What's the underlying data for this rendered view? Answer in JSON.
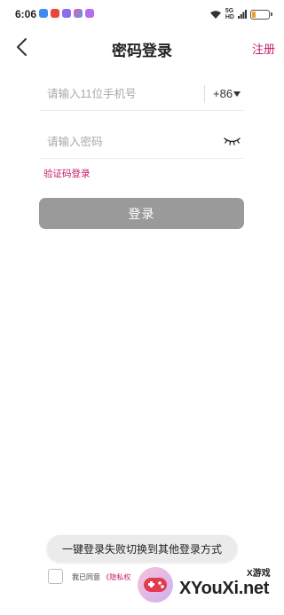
{
  "status_bar": {
    "time": "6:06",
    "signal_label_top": "5G",
    "signal_label_bottom": "HD",
    "battery_level": 0.2
  },
  "header": {
    "title": "密码登录",
    "register_label": "注册"
  },
  "phone": {
    "placeholder": "请输入11位手机号",
    "country_code": "+86"
  },
  "password": {
    "placeholder": "请输入密码"
  },
  "sms_login_label": "验证码登录",
  "login_button_label": "登录",
  "toast": "一键登录失败切换到其他登录方式",
  "agreement": {
    "prefix": "我已同意",
    "link": "《隐私权"
  },
  "watermark": {
    "small": "X游戏",
    "large": "XYouXi.net"
  },
  "colors": {
    "accent": "#c71a67",
    "button_disabled": "#9a9a9a"
  }
}
